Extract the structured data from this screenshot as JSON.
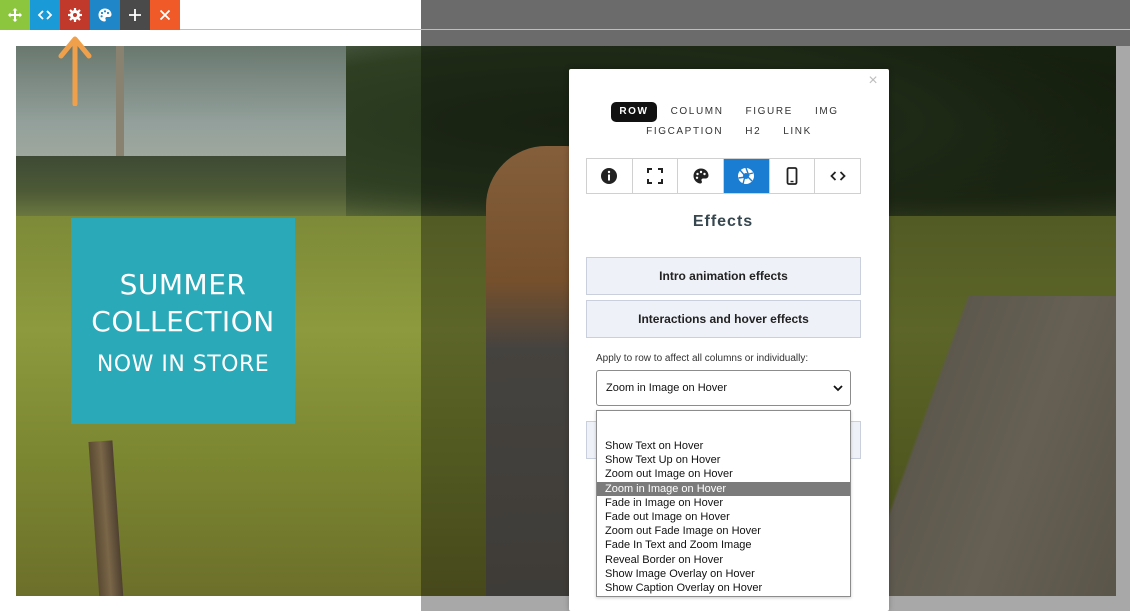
{
  "toolbar": {
    "buttons": [
      {
        "icon": "move-icon",
        "color": "#8cc63f"
      },
      {
        "icon": "code-icon",
        "color": "#1a9ad6"
      },
      {
        "icon": "gear-icon",
        "color": "#c0392b"
      },
      {
        "icon": "palette-icon",
        "color": "#1f86c8"
      },
      {
        "icon": "plus-icon",
        "color": "#4a4a4a"
      },
      {
        "icon": "close-icon",
        "color": "#f05a28"
      }
    ]
  },
  "hero": {
    "heading": "SUMMER COLLECTION",
    "subheading": "NOW IN STORE",
    "card_color": "#2aa9b8"
  },
  "panel": {
    "close_label": "×",
    "element_tags_row1": [
      "ROW",
      "COLUMN",
      "FIGURE",
      "IMG"
    ],
    "element_tags_row2": [
      "FIGCAPTION",
      "H2",
      "LINK"
    ],
    "active_tag": "ROW",
    "tabs": [
      {
        "icon": "info-icon"
      },
      {
        "icon": "expand-icon"
      },
      {
        "icon": "palette-icon"
      },
      {
        "icon": "aperture-icon"
      },
      {
        "icon": "mobile-icon"
      },
      {
        "icon": "code-icon"
      }
    ],
    "active_tab_color": "#1b7dd1",
    "section_title": "Effects",
    "accordion": [
      "Intro animation effects",
      "Interactions and hover effects"
    ],
    "hint": "Apply to row to affect all columns or individually:",
    "select_value": "Zoom in Image on Hover",
    "options": [
      "Show Text on Hover",
      "Show Text Up on Hover",
      "Zoom out Image on Hover",
      "Zoom in Image on Hover",
      "Fade in Image on Hover",
      "Fade out Image on Hover",
      "Zoom out Fade Image on Hover",
      "Fade In Text and Zoom Image",
      "Reveal Border on Hover",
      "Show Image Overlay on Hover",
      "Show Caption Overlay on Hover"
    ],
    "selected_option_index": 3
  }
}
